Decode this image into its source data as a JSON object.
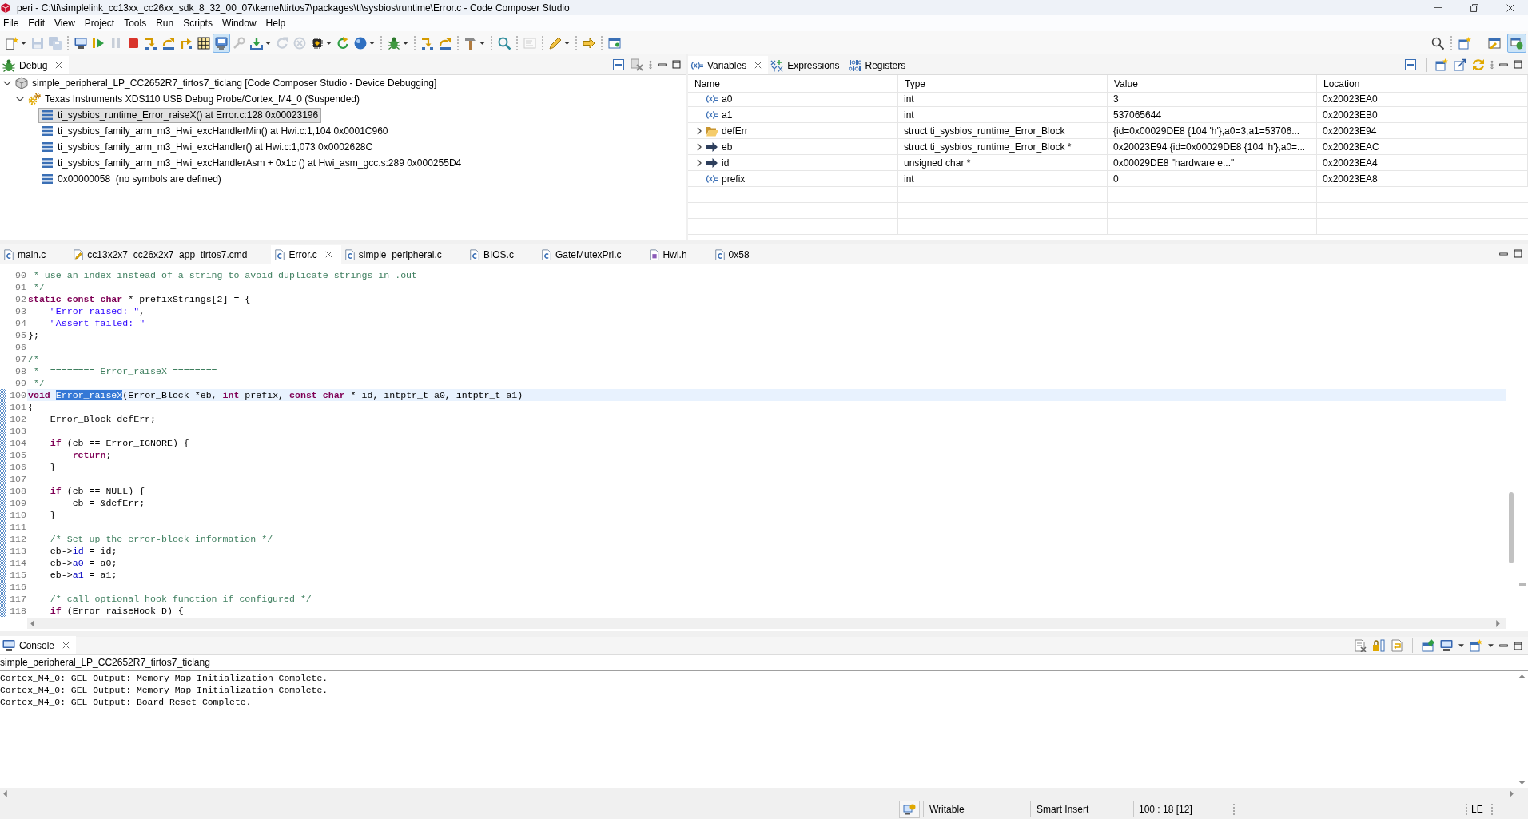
{
  "window": {
    "title": "peri - C:\\ti\\simplelink_cc13xx_cc26xx_sdk_8_32_00_07\\kernel\\tirtos7\\packages\\ti\\sysbios\\runtime\\Error.c - Code Composer Studio"
  },
  "menu": [
    "File",
    "Edit",
    "View",
    "Project",
    "Tools",
    "Run",
    "Scripts",
    "Window",
    "Help"
  ],
  "toolbar": {
    "groups": [
      {
        "items": [
          {
            "kind": "new",
            "dropdown": true,
            "disabled": false,
            "on": false
          },
          {
            "kind": "save",
            "dropdown": false,
            "disabled": true,
            "on": false
          },
          {
            "kind": "save-all",
            "dropdown": false,
            "disabled": true,
            "on": false
          }
        ]
      },
      {
        "items": [
          {
            "kind": "monitor",
            "dropdown": false,
            "disabled": false,
            "on": false
          },
          {
            "kind": "resume",
            "dropdown": false,
            "disabled": false,
            "on": false
          },
          {
            "kind": "suspend",
            "dropdown": false,
            "disabled": true,
            "on": false
          },
          {
            "kind": "terminate",
            "dropdown": false,
            "disabled": false,
            "on": false
          },
          {
            "kind": "step-into",
            "dropdown": false,
            "disabled": false,
            "on": false
          },
          {
            "kind": "step-over",
            "dropdown": false,
            "disabled": false,
            "on": false
          },
          {
            "kind": "step-return",
            "dropdown": false,
            "disabled": false,
            "on": false
          },
          {
            "kind": "grid",
            "dropdown": false,
            "disabled": false,
            "on": false
          },
          {
            "kind": "board",
            "dropdown": false,
            "disabled": false,
            "on": true
          },
          {
            "kind": "wrench",
            "dropdown": false,
            "disabled": true,
            "on": false
          },
          {
            "kind": "download",
            "dropdown": true,
            "disabled": false,
            "on": false
          },
          {
            "kind": "restart",
            "dropdown": false,
            "disabled": true,
            "on": false
          },
          {
            "kind": "reset",
            "dropdown": false,
            "disabled": true,
            "on": false
          },
          {
            "kind": "chip",
            "dropdown": true,
            "disabled": false,
            "on": false
          },
          {
            "kind": "reload",
            "dropdown": false,
            "disabled": false,
            "on": false
          },
          {
            "kind": "sphere",
            "dropdown": true,
            "disabled": false,
            "on": false
          }
        ]
      },
      {
        "items": [
          {
            "kind": "bug",
            "dropdown": true,
            "disabled": false,
            "on": false
          }
        ]
      },
      {
        "items": [
          {
            "kind": "step-into",
            "dropdown": false,
            "disabled": false,
            "on": false
          },
          {
            "kind": "step-over",
            "dropdown": false,
            "disabled": false,
            "on": false
          }
        ]
      },
      {
        "items": [
          {
            "kind": "hammer",
            "dropdown": true,
            "disabled": false,
            "on": false
          }
        ]
      },
      {
        "items": [
          {
            "kind": "search",
            "dropdown": false,
            "disabled": false,
            "on": false
          }
        ]
      },
      {
        "items": [
          {
            "kind": "console",
            "dropdown": false,
            "disabled": true,
            "on": false
          }
        ]
      },
      {
        "items": [
          {
            "kind": "pen",
            "dropdown": true,
            "disabled": false,
            "on": false
          }
        ]
      },
      {
        "items": [
          {
            "kind": "arrow",
            "dropdown": false,
            "disabled": false,
            "on": false
          }
        ]
      },
      {
        "items": [
          {
            "kind": "window",
            "dropdown": false,
            "disabled": false,
            "on": false
          }
        ]
      }
    ]
  },
  "perspectives": [
    {
      "kind": "edit",
      "selected": false
    },
    {
      "kind": "debug",
      "selected": true
    }
  ],
  "debug_view": {
    "tabs": [
      {
        "kind": "debug",
        "label": "Debug",
        "selected": true
      }
    ],
    "tree": [
      {
        "kind": "launch",
        "label": "simple_peripheral_LP_CC2652R7_tirtos7_ticlang [Code Composer Studio - Device Debugging]",
        "expanded": true,
        "selected": false,
        "children": [
          {
            "kind": "probe",
            "label": "Texas Instruments XDS110 USB Debug Probe/Cortex_M4_0 (Suspended)",
            "expanded": true,
            "selected": false,
            "children": [
              {
                "kind": "frame",
                "label": "ti_sysbios_runtime_Error_raiseX() at Error.c:128 0x00023196",
                "selected": true
              },
              {
                "kind": "frame",
                "label": "ti_sysbios_family_arm_m3_Hwi_excHandlerMin() at Hwi.c:1,104 0x0001C960",
                "selected": false
              },
              {
                "kind": "frame",
                "label": "ti_sysbios_family_arm_m3_Hwi_excHandler() at Hwi.c:1,073 0x0002628C",
                "selected": false
              },
              {
                "kind": "frame",
                "label": "ti_sysbios_family_arm_m3_Hwi_excHandlerAsm + 0x1c () at Hwi_asm_gcc.s:289 0x000255D4",
                "selected": false
              },
              {
                "kind": "frame",
                "label": "0x00000058  (no symbols are defined)",
                "selected": false
              }
            ]
          }
        ]
      }
    ]
  },
  "variables_view": {
    "tabs": [
      {
        "kind": "variables",
        "label": "Variables",
        "selected": true
      },
      {
        "kind": "expressions",
        "label": "Expressions",
        "selected": false
      },
      {
        "kind": "registers",
        "label": "Registers",
        "selected": false
      }
    ],
    "columns": [
      "Name",
      "Type",
      "Value",
      "Location"
    ],
    "rows": [
      {
        "kind": "local",
        "name": "a0",
        "type": "int",
        "value": "3",
        "location": "0x20023EA0"
      },
      {
        "kind": "local",
        "name": "a1",
        "type": "int",
        "value": "537065644",
        "location": "0x20023EB0"
      },
      {
        "kind": "struct",
        "expanded": false,
        "name": "defErr",
        "type": "struct ti_sysbios_runtime_Error_Block",
        "value": "{id=0x00029DE8 {104 'h'},a0=3,a1=53706...",
        "location": "0x20023E94"
      },
      {
        "kind": "pointer",
        "expanded": false,
        "name": "eb",
        "type": "struct ti_sysbios_runtime_Error_Block *",
        "value": "0x20023E94 {id=0x00029DE8 {104 'h'},a0=...",
        "location": "0x20023EAC"
      },
      {
        "kind": "pointer",
        "expanded": false,
        "name": "id",
        "type": "unsigned char *",
        "value": "0x00029DE8 \"hardware e...\"",
        "location": "0x20023EA4"
      },
      {
        "kind": "local",
        "name": "prefix",
        "type": "int",
        "value": "0",
        "location": "0x20023EA8"
      }
    ]
  },
  "editor": {
    "tabs": [
      {
        "kind": "source",
        "label": "main.c",
        "selected": false
      },
      {
        "kind": "linker",
        "label": "cc13x2x7_cc26x2x7_app_tirtos7.cmd",
        "selected": false
      },
      {
        "kind": "source",
        "label": "Error.c",
        "selected": true
      },
      {
        "kind": "source",
        "label": "simple_peripheral.c",
        "selected": false
      },
      {
        "kind": "source",
        "label": "BIOS.c",
        "selected": false
      },
      {
        "kind": "source",
        "label": "GateMutexPri.c",
        "selected": false
      },
      {
        "kind": "header",
        "label": "Hwi.h",
        "selected": false
      },
      {
        "kind": "disassembly",
        "label": "0x58",
        "selected": false
      }
    ],
    "lines": [
      {
        "number": "90",
        "current": false,
        "in_range": false,
        "tokens": [
          {
            "kind": "comment",
            "text": " * use an index instead of a string to avoid duplicate strings in .out"
          }
        ]
      },
      {
        "number": "91",
        "current": false,
        "in_range": false,
        "tokens": [
          {
            "kind": "comment",
            "text": " */"
          }
        ]
      },
      {
        "number": "92",
        "current": false,
        "in_range": false,
        "tokens": [
          {
            "kind": "keyword",
            "text": "static "
          },
          {
            "kind": "keyword",
            "text": "const "
          },
          {
            "kind": "keyword",
            "text": "char"
          },
          {
            "kind": "plain",
            "text": " * prefixStrings[2] = {"
          }
        ]
      },
      {
        "number": "93",
        "current": false,
        "in_range": false,
        "tokens": [
          {
            "kind": "string",
            "text": "    \"Error raised: \""
          },
          {
            "kind": "plain",
            "text": ","
          }
        ]
      },
      {
        "number": "94",
        "current": false,
        "in_range": false,
        "tokens": [
          {
            "kind": "string",
            "text": "    \"Assert failed: \""
          }
        ]
      },
      {
        "number": "95",
        "current": false,
        "in_range": false,
        "tokens": [
          {
            "kind": "plain",
            "text": "};"
          }
        ]
      },
      {
        "number": "96",
        "current": false,
        "in_range": false
      },
      {
        "number": "97",
        "current": false,
        "in_range": false,
        "tokens": [
          {
            "kind": "comment",
            "text": "/*"
          }
        ]
      },
      {
        "number": "98",
        "current": false,
        "in_range": false,
        "tokens": [
          {
            "kind": "comment",
            "text": " *  ======== Error_raiseX ========"
          }
        ]
      },
      {
        "number": "99",
        "current": false,
        "in_range": false,
        "tokens": [
          {
            "kind": "comment",
            "text": " */"
          }
        ]
      },
      {
        "number": "100",
        "current": true,
        "in_range": true,
        "tokens": [
          {
            "kind": "keyword",
            "text": "void "
          },
          {
            "kind": "selection",
            "text": "Error_raiseX"
          },
          {
            "kind": "plain",
            "text": "(Error_Block *eb, "
          },
          {
            "kind": "keyword",
            "text": "int"
          },
          {
            "kind": "plain",
            "text": " prefix, "
          },
          {
            "kind": "keyword",
            "text": "const "
          },
          {
            "kind": "keyword",
            "text": "char"
          },
          {
            "kind": "plain",
            "text": " * id, intptr_t a0, intptr_t a1)"
          }
        ]
      },
      {
        "number": "101",
        "current": false,
        "in_range": true,
        "tokens": [
          {
            "kind": "plain",
            "text": "{"
          }
        ]
      },
      {
        "number": "102",
        "current": false,
        "in_range": true,
        "tokens": [
          {
            "kind": "plain",
            "text": "    Error_Block defErr;"
          }
        ]
      },
      {
        "number": "103",
        "current": false,
        "in_range": true
      },
      {
        "number": "104",
        "current": false,
        "in_range": true,
        "tokens": [
          {
            "kind": "keyword",
            "text": "    if"
          },
          {
            "kind": "plain",
            "text": " (eb == Error_IGNORE) {"
          }
        ]
      },
      {
        "number": "105",
        "current": false,
        "in_range": true,
        "tokens": [
          {
            "kind": "keyword",
            "text": "        return"
          },
          {
            "kind": "plain",
            "text": ";"
          }
        ]
      },
      {
        "number": "106",
        "current": false,
        "in_range": true,
        "tokens": [
          {
            "kind": "plain",
            "text": "    }"
          }
        ]
      },
      {
        "number": "107",
        "current": false,
        "in_range": true
      },
      {
        "number": "108",
        "current": false,
        "in_range": true,
        "tokens": [
          {
            "kind": "keyword",
            "text": "    if"
          },
          {
            "kind": "plain",
            "text": " (eb == NULL) {"
          }
        ]
      },
      {
        "number": "109",
        "current": false,
        "in_range": true,
        "tokens": [
          {
            "kind": "plain",
            "text": "        eb = &defErr;"
          }
        ]
      },
      {
        "number": "110",
        "current": false,
        "in_range": true,
        "tokens": [
          {
            "kind": "plain",
            "text": "    }"
          }
        ]
      },
      {
        "number": "111",
        "current": false,
        "in_range": true
      },
      {
        "number": "112",
        "current": false,
        "in_range": true,
        "tokens": [
          {
            "kind": "comment",
            "text": "    /* Set up the error-block information */"
          }
        ]
      },
      {
        "number": "113",
        "current": false,
        "in_range": true,
        "tokens": [
          {
            "kind": "plain",
            "text": "    eb->"
          },
          {
            "kind": "field",
            "text": "id"
          },
          {
            "kind": "plain",
            "text": " = id;"
          }
        ]
      },
      {
        "number": "114",
        "current": false,
        "in_range": true,
        "tokens": [
          {
            "kind": "plain",
            "text": "    eb->"
          },
          {
            "kind": "field",
            "text": "a0"
          },
          {
            "kind": "plain",
            "text": " = a0;"
          }
        ]
      },
      {
        "number": "115",
        "current": false,
        "in_range": true,
        "tokens": [
          {
            "kind": "plain",
            "text": "    eb->"
          },
          {
            "kind": "field",
            "text": "a1"
          },
          {
            "kind": "plain",
            "text": " = a1;"
          }
        ]
      },
      {
        "number": "116",
        "current": false,
        "in_range": true
      },
      {
        "number": "117",
        "current": false,
        "in_range": true,
        "tokens": [
          {
            "kind": "comment",
            "text": "    /* call optional hook function if configured */"
          }
        ]
      },
      {
        "number": "118",
        "current": false,
        "in_range": true,
        "tokens": [
          {
            "kind": "keyword",
            "text": "    if"
          },
          {
            "kind": "plain",
            "text": " (Error raiseHook D) {"
          }
        ]
      }
    ]
  },
  "console": {
    "tabs": [
      {
        "kind": "console",
        "label": "Console",
        "selected": true
      }
    ],
    "title": "simple_peripheral_LP_CC2652R7_tirtos7_ticlang",
    "lines": [
      "Cortex_M4_0: GEL Output: Memory Map Initialization Complete.",
      "Cortex_M4_0: GEL Output: Memory Map Initialization Complete.",
      "Cortex_M4_0: GEL Output: Board Reset Complete."
    ]
  },
  "status_bar": {
    "writable": "Writable",
    "insert_mode": "Smart Insert",
    "cursor_position": "100 : 18 [12]",
    "endianness": "LE"
  }
}
